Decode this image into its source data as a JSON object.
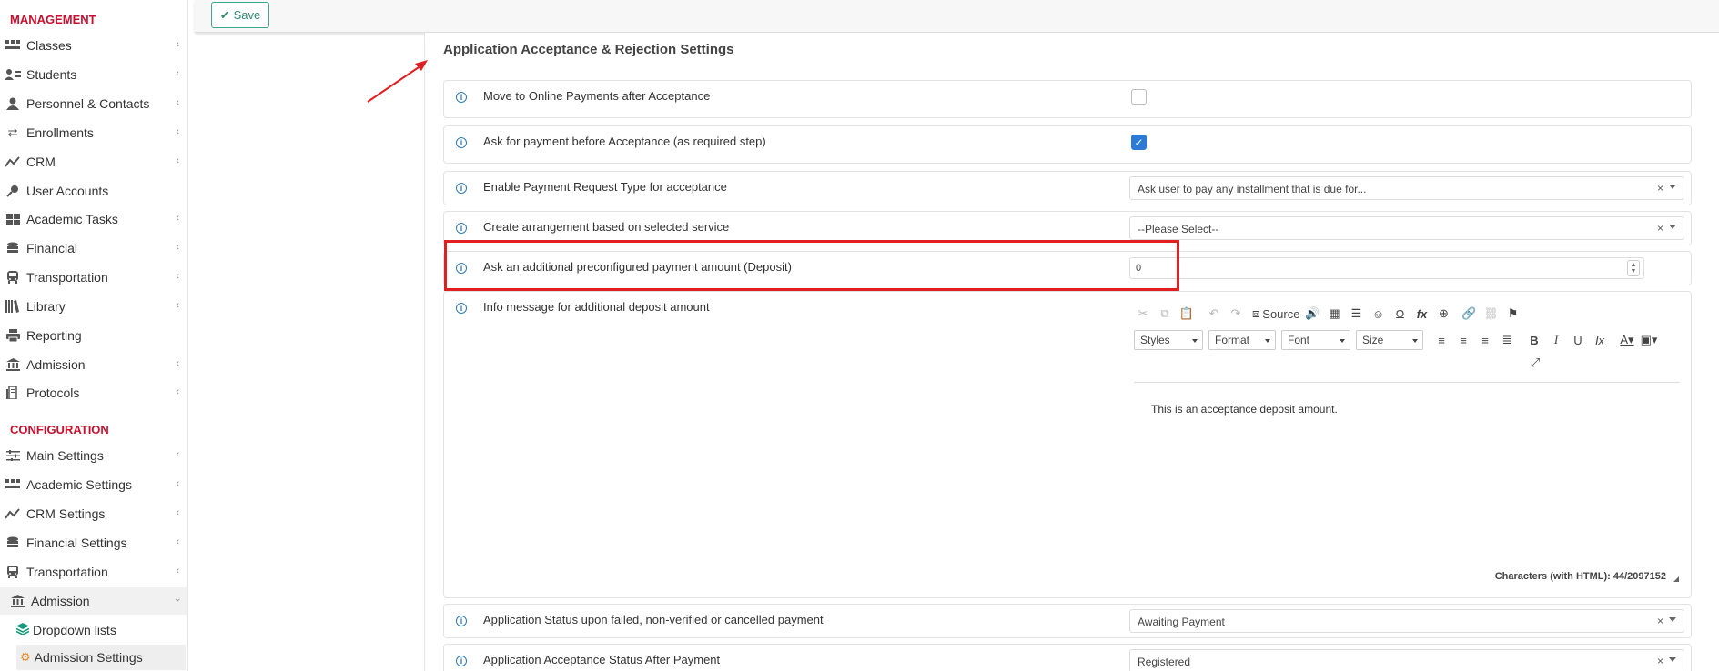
{
  "sidebar": {
    "management_title": "MANAGEMENT",
    "configuration_title": "CONFIGURATION",
    "management_items": [
      {
        "label": "Classes",
        "icon": "classes-icon",
        "chevron": "‹"
      },
      {
        "label": "Students",
        "icon": "students-icon",
        "chevron": "‹"
      },
      {
        "label": "Personnel & Contacts",
        "icon": "personnel-icon",
        "chevron": "‹"
      },
      {
        "label": "Enrollments",
        "icon": "enrollments-icon",
        "chevron": "‹"
      },
      {
        "label": "CRM",
        "icon": "crm-icon",
        "chevron": "‹"
      },
      {
        "label": "User Accounts",
        "icon": "key-icon",
        "chevron": ""
      },
      {
        "label": "Academic Tasks",
        "icon": "grid-icon",
        "chevron": "‹"
      },
      {
        "label": "Financial",
        "icon": "coins-icon",
        "chevron": "‹"
      },
      {
        "label": "Transportation",
        "icon": "bus-icon",
        "chevron": "‹"
      },
      {
        "label": "Library",
        "icon": "library-icon",
        "chevron": "‹"
      },
      {
        "label": "Reporting",
        "icon": "printer-icon",
        "chevron": ""
      },
      {
        "label": "Admission",
        "icon": "institution-icon",
        "chevron": "‹"
      },
      {
        "label": "Protocols",
        "icon": "protocols-icon",
        "chevron": "‹"
      }
    ],
    "configuration_items": [
      {
        "label": "Main Settings",
        "icon": "sliders-icon",
        "chevron": "‹"
      },
      {
        "label": "Academic Settings",
        "icon": "classes-icon",
        "chevron": "‹"
      },
      {
        "label": "CRM Settings",
        "icon": "crm-icon",
        "chevron": "‹"
      },
      {
        "label": "Financial Settings",
        "icon": "coins-icon",
        "chevron": "‹"
      },
      {
        "label": "Transportation",
        "icon": "bus-icon",
        "chevron": "‹"
      },
      {
        "label": "Admission",
        "icon": "institution-icon",
        "chevron": "›"
      }
    ],
    "submenu": [
      {
        "label": "Dropdown lists",
        "icon": "layers-icon"
      },
      {
        "label": "Admission Settings",
        "icon": "cog-icon"
      }
    ]
  },
  "toolbar": {
    "save_label": "Save",
    "save_icon": "check-icon"
  },
  "section_title": "Application Acceptance & Rejection Settings",
  "settings": {
    "online_payments": {
      "label": "Move to Online Payments after Acceptance",
      "checked": false
    },
    "payment_before": {
      "label": "Ask for payment before Acceptance (as required step)",
      "checked": true
    },
    "payment_request_type": {
      "label": "Enable Payment Request Type for acceptance",
      "value": "Ask user to pay any installment that is due for..."
    },
    "arrangement": {
      "label": "Create arrangement based on selected service",
      "value": "--Please Select--"
    },
    "deposit": {
      "label": "Ask an additional preconfigured payment amount (Deposit)",
      "value": "0"
    },
    "info_message": {
      "label": "Info message for additional deposit amount"
    },
    "failed_status": {
      "label": "Application Status upon failed, non-verified or cancelled payment",
      "value": "Awaiting Payment"
    },
    "acceptance_status": {
      "label": "Application Acceptance Status After Payment",
      "value": "Registered"
    }
  },
  "editor": {
    "source_label": "Source",
    "combos": {
      "styles": "Styles",
      "format": "Format",
      "font": "Font",
      "size": "Size"
    },
    "content": "This is an acceptance deposit amount.",
    "char_count": "Characters (with HTML): 44/2097152"
  },
  "colors": {
    "accent_red": "#c8102e",
    "highlight": "#e02020",
    "save_green": "#2e8b6f",
    "checkbox_blue": "#2d7ad6"
  }
}
